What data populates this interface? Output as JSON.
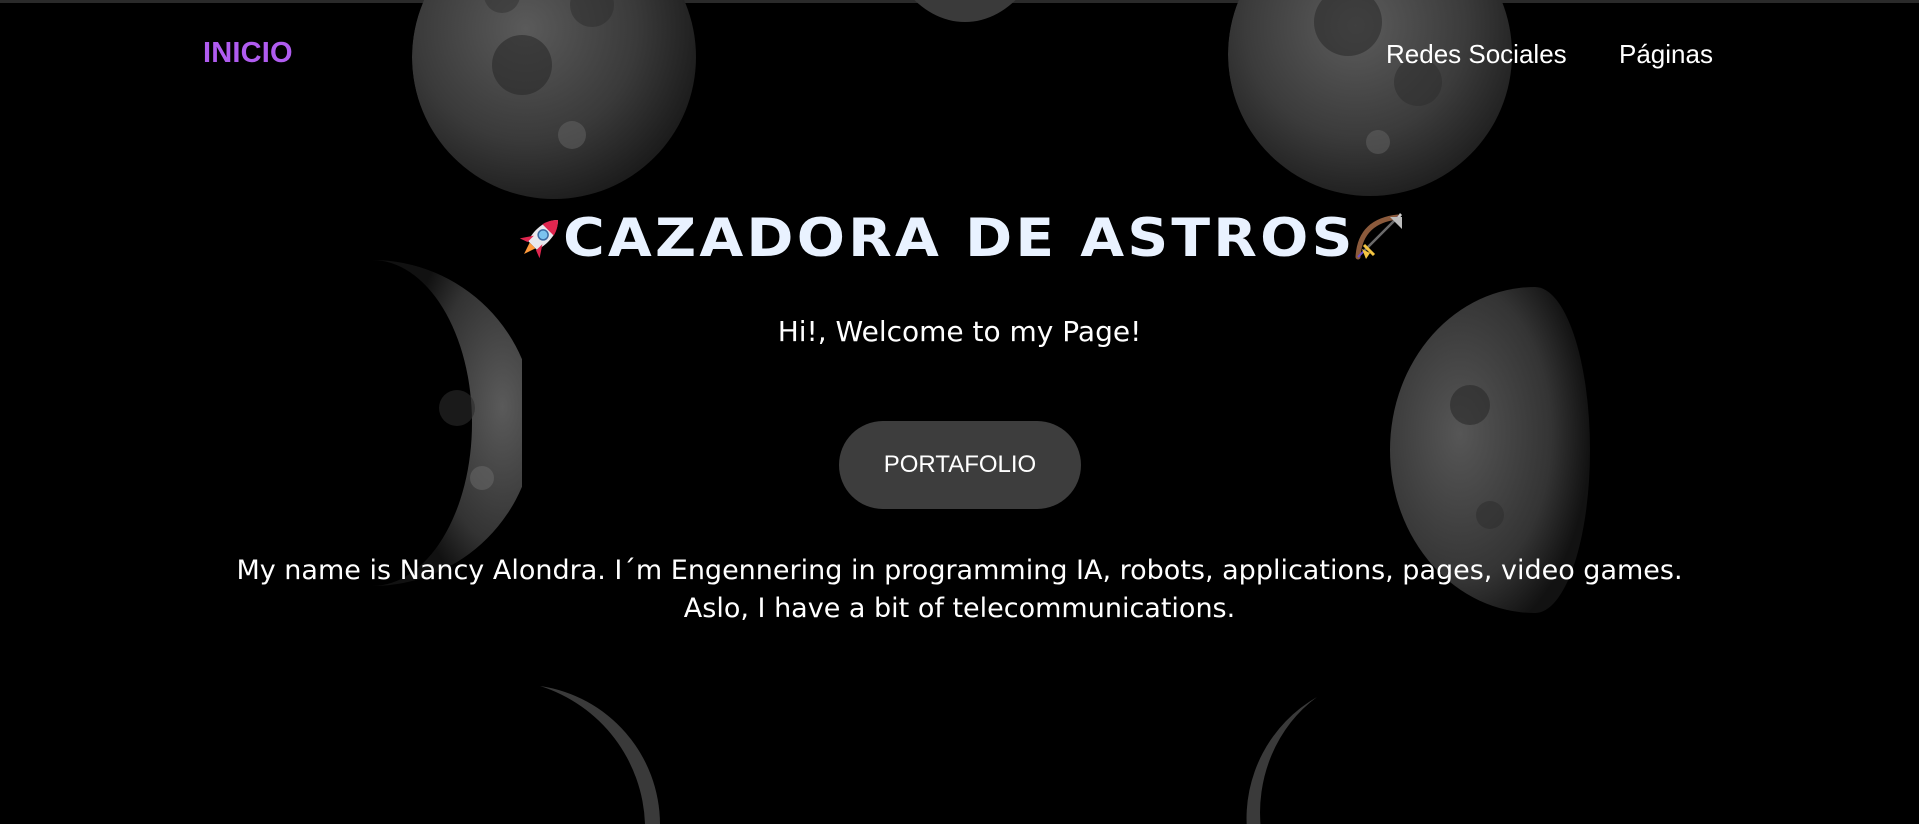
{
  "nav": {
    "brand": "INICIO",
    "links": [
      "Redes Sociales",
      "Páginas"
    ]
  },
  "hero": {
    "title": "CAZADORA DE ASTROS",
    "title_left_icon": "rocket-emoji",
    "title_right_icon": "bow-and-arrow-emoji",
    "welcome": "Hi!, Welcome to my Page!",
    "button_label": "PORTAFOLIO",
    "about": "My name is Nancy Alondra. I´m Engennering in programming IA, robots, applications, pages, video games. Aslo, I have a bit of telecommunications."
  },
  "colors": {
    "background": "#000000",
    "brand": "#b05cf0",
    "button_bg": "#3d3d3d",
    "title": "#e9f2ff",
    "text": "#ffffff"
  }
}
